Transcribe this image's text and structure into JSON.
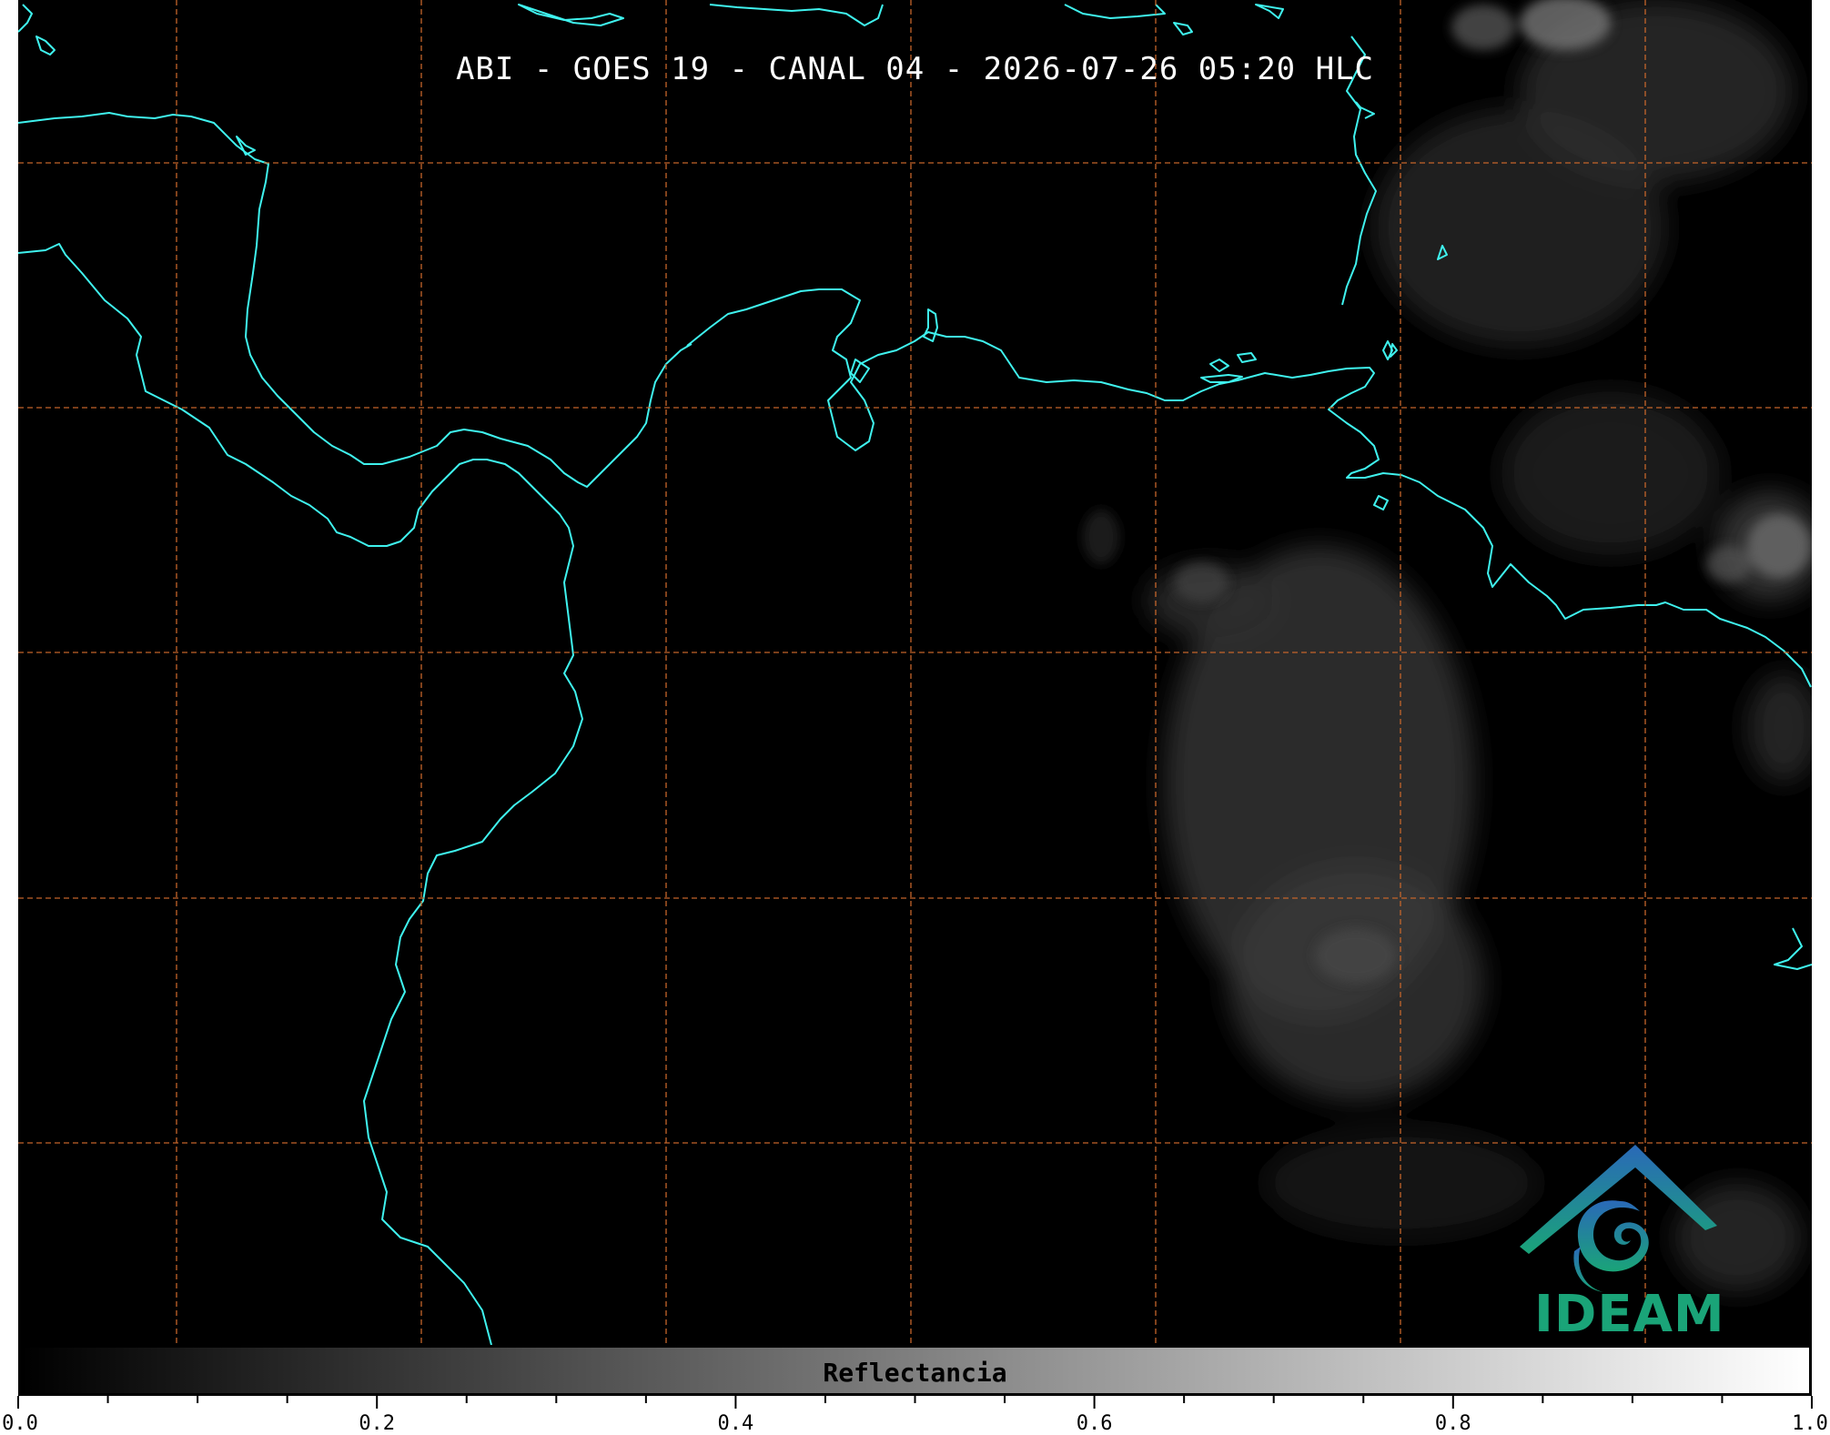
{
  "title": "ABI - GOES 19 - CANAL 04 - 2026-07-26 05:20 HLC",
  "logo": {
    "text": "IDEAM",
    "icon": "ideam-logo-icon"
  },
  "colorbar": {
    "label": "Reflectancia",
    "range": [
      0.0,
      1.0
    ],
    "ticks": [
      "0.0",
      "0.2",
      "0.4",
      "0.6",
      "0.8",
      "1.0"
    ],
    "minor_ticks": 20,
    "colormap": [
      "#000000",
      "#ffffff"
    ]
  },
  "colors": {
    "coastline": "#3ff2ee",
    "gridlines": "#c4642a",
    "background": "#000000"
  }
}
